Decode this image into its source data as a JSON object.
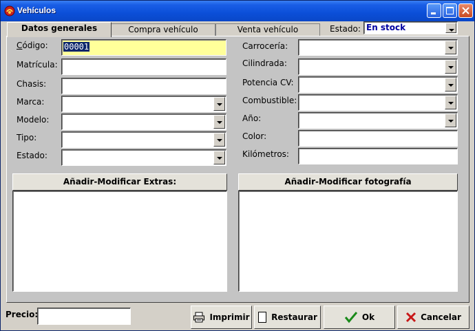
{
  "window": {
    "title": "Vehículos"
  },
  "tabs": [
    {
      "label": "Datos generales",
      "active": true
    },
    {
      "label": "Compra vehículo",
      "active": false
    },
    {
      "label": "Venta vehículo",
      "active": false
    }
  ],
  "estado_top": {
    "label": "Estado:",
    "value": "En stock"
  },
  "left_fields": {
    "codigo": {
      "label": "Código:",
      "value": "00001"
    },
    "matricula": {
      "label": "Matrícula:",
      "value": ""
    },
    "chasis": {
      "label": "Chasis:",
      "value": ""
    },
    "marca": {
      "label": "Marca:",
      "value": ""
    },
    "modelo": {
      "label": "Modelo:",
      "value": ""
    },
    "tipo": {
      "label": "Tipo:",
      "value": ""
    },
    "estado": {
      "label": "Estado:",
      "value": ""
    }
  },
  "right_fields": {
    "carroceria": {
      "label": "Carrocería:",
      "value": ""
    },
    "cilindrada": {
      "label": "Cilindrada:",
      "value": ""
    },
    "potencia": {
      "label": "Potencia CV:",
      "value": ""
    },
    "combustible": {
      "label": "Combustible:",
      "value": ""
    },
    "anio": {
      "label": "Año:",
      "value": ""
    },
    "color": {
      "label": "Color:",
      "value": ""
    },
    "kilometros": {
      "label": "Kilómetros:",
      "value": ""
    }
  },
  "sections": {
    "extras_button": "Añadir-Modificar Extras:",
    "foto_button": "Añadir-Modificar fotografía"
  },
  "footer": {
    "precio_label": "Precio:",
    "precio_value": "",
    "imprimir": "Imprimir",
    "restaurar": "Restaurar",
    "ok": "Ok",
    "cancelar": "Cancelar"
  },
  "colors": {
    "titlebar": "#0b4fd8",
    "codigo_bg": "#ffff9a",
    "estado_value": "#0000a0",
    "ok_check": "#1a8a1a",
    "cancel_x": "#c81818"
  },
  "icons": {
    "app": "app-icon",
    "minimize": "minimize-icon",
    "maximize": "maximize-icon",
    "close": "close-icon",
    "print": "printer-icon",
    "restore": "document-icon",
    "ok": "checkmark-icon",
    "cancel": "x-icon"
  }
}
